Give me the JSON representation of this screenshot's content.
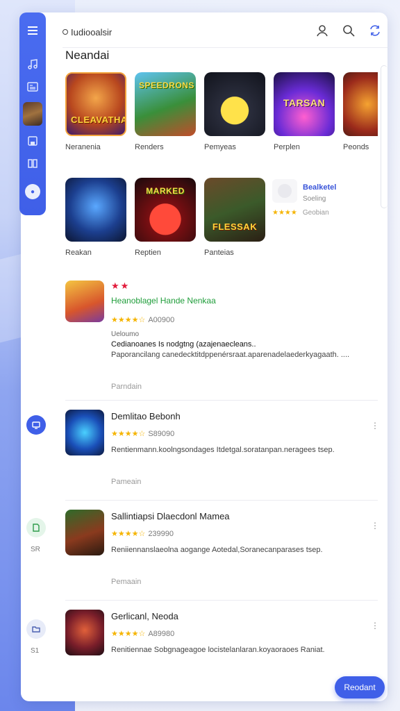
{
  "app": {
    "title": "Iudiooalsir"
  },
  "section": {
    "title": "Neandai"
  },
  "tiles": [
    {
      "caption": "Neranenia",
      "art_text": "CLEAVATHA"
    },
    {
      "caption": "Renders",
      "art_text": "SPEEDRONS"
    },
    {
      "caption": "Pemyeas",
      "art_text": ""
    },
    {
      "caption": "Perplen",
      "art_text": "TARSAN"
    },
    {
      "caption": "Peonds",
      "art_text": ""
    },
    {
      "caption": "Reakan",
      "art_text": ""
    },
    {
      "caption": "Reptien",
      "art_text": "MARKED"
    },
    {
      "caption": "Panteias",
      "art_text": "FLESSAK"
    }
  ],
  "mini_card": {
    "name": "Bealketel",
    "sub": "Soeling",
    "stars": "★★★★",
    "count": "Geobian"
  },
  "featured": {
    "badge": "★★",
    "name": "Heanoblagel Hande Nenkaa",
    "stars": "★★★★☆",
    "count": "A00900",
    "line1": "Ueloumo",
    "line2": "Cedianoanes Is nodgtng (azajenaecleans..",
    "line3": "Paporancilang canedecktitdppenérsraat.aparenadelaederkyagaath. ....",
    "more": "Parndain"
  },
  "rows": [
    {
      "name": "Demlitao Bebonh",
      "stars": "★★★★☆",
      "count": "S89090",
      "desc": "Rentienmann.koolngsondages Itdetgal.soratanpan.neragees tsep.",
      "more": "Pameain",
      "side_label": ""
    },
    {
      "name": "Sallintiapsi Dlaecdonl Mamea",
      "stars": "★★★★☆",
      "count": "239990",
      "desc": "Reniiennanslaeolna aogange Aotedal,Soranecanparases tsep.",
      "more": "Pemaain",
      "side_label": "SR"
    },
    {
      "name": "Gerlicanl, Neoda",
      "stars": "★★★★☆",
      "count": "A89980",
      "desc": "Renitiennae Sobgnageagoe locistelanlaran.koyaoraoes Raniat.",
      "more": "",
      "side_label": "S1"
    }
  ],
  "fab": {
    "label": "Reodant"
  },
  "colors": {
    "accent": "#3f5fe8",
    "star": "#f5b400",
    "featured_name": "#1f9d3a",
    "badge": "#e21b3c"
  },
  "icons": [
    "menu-icon",
    "music-icon",
    "news-icon",
    "save-icon",
    "book-icon",
    "user-icon",
    "search-icon",
    "sync-icon"
  ]
}
